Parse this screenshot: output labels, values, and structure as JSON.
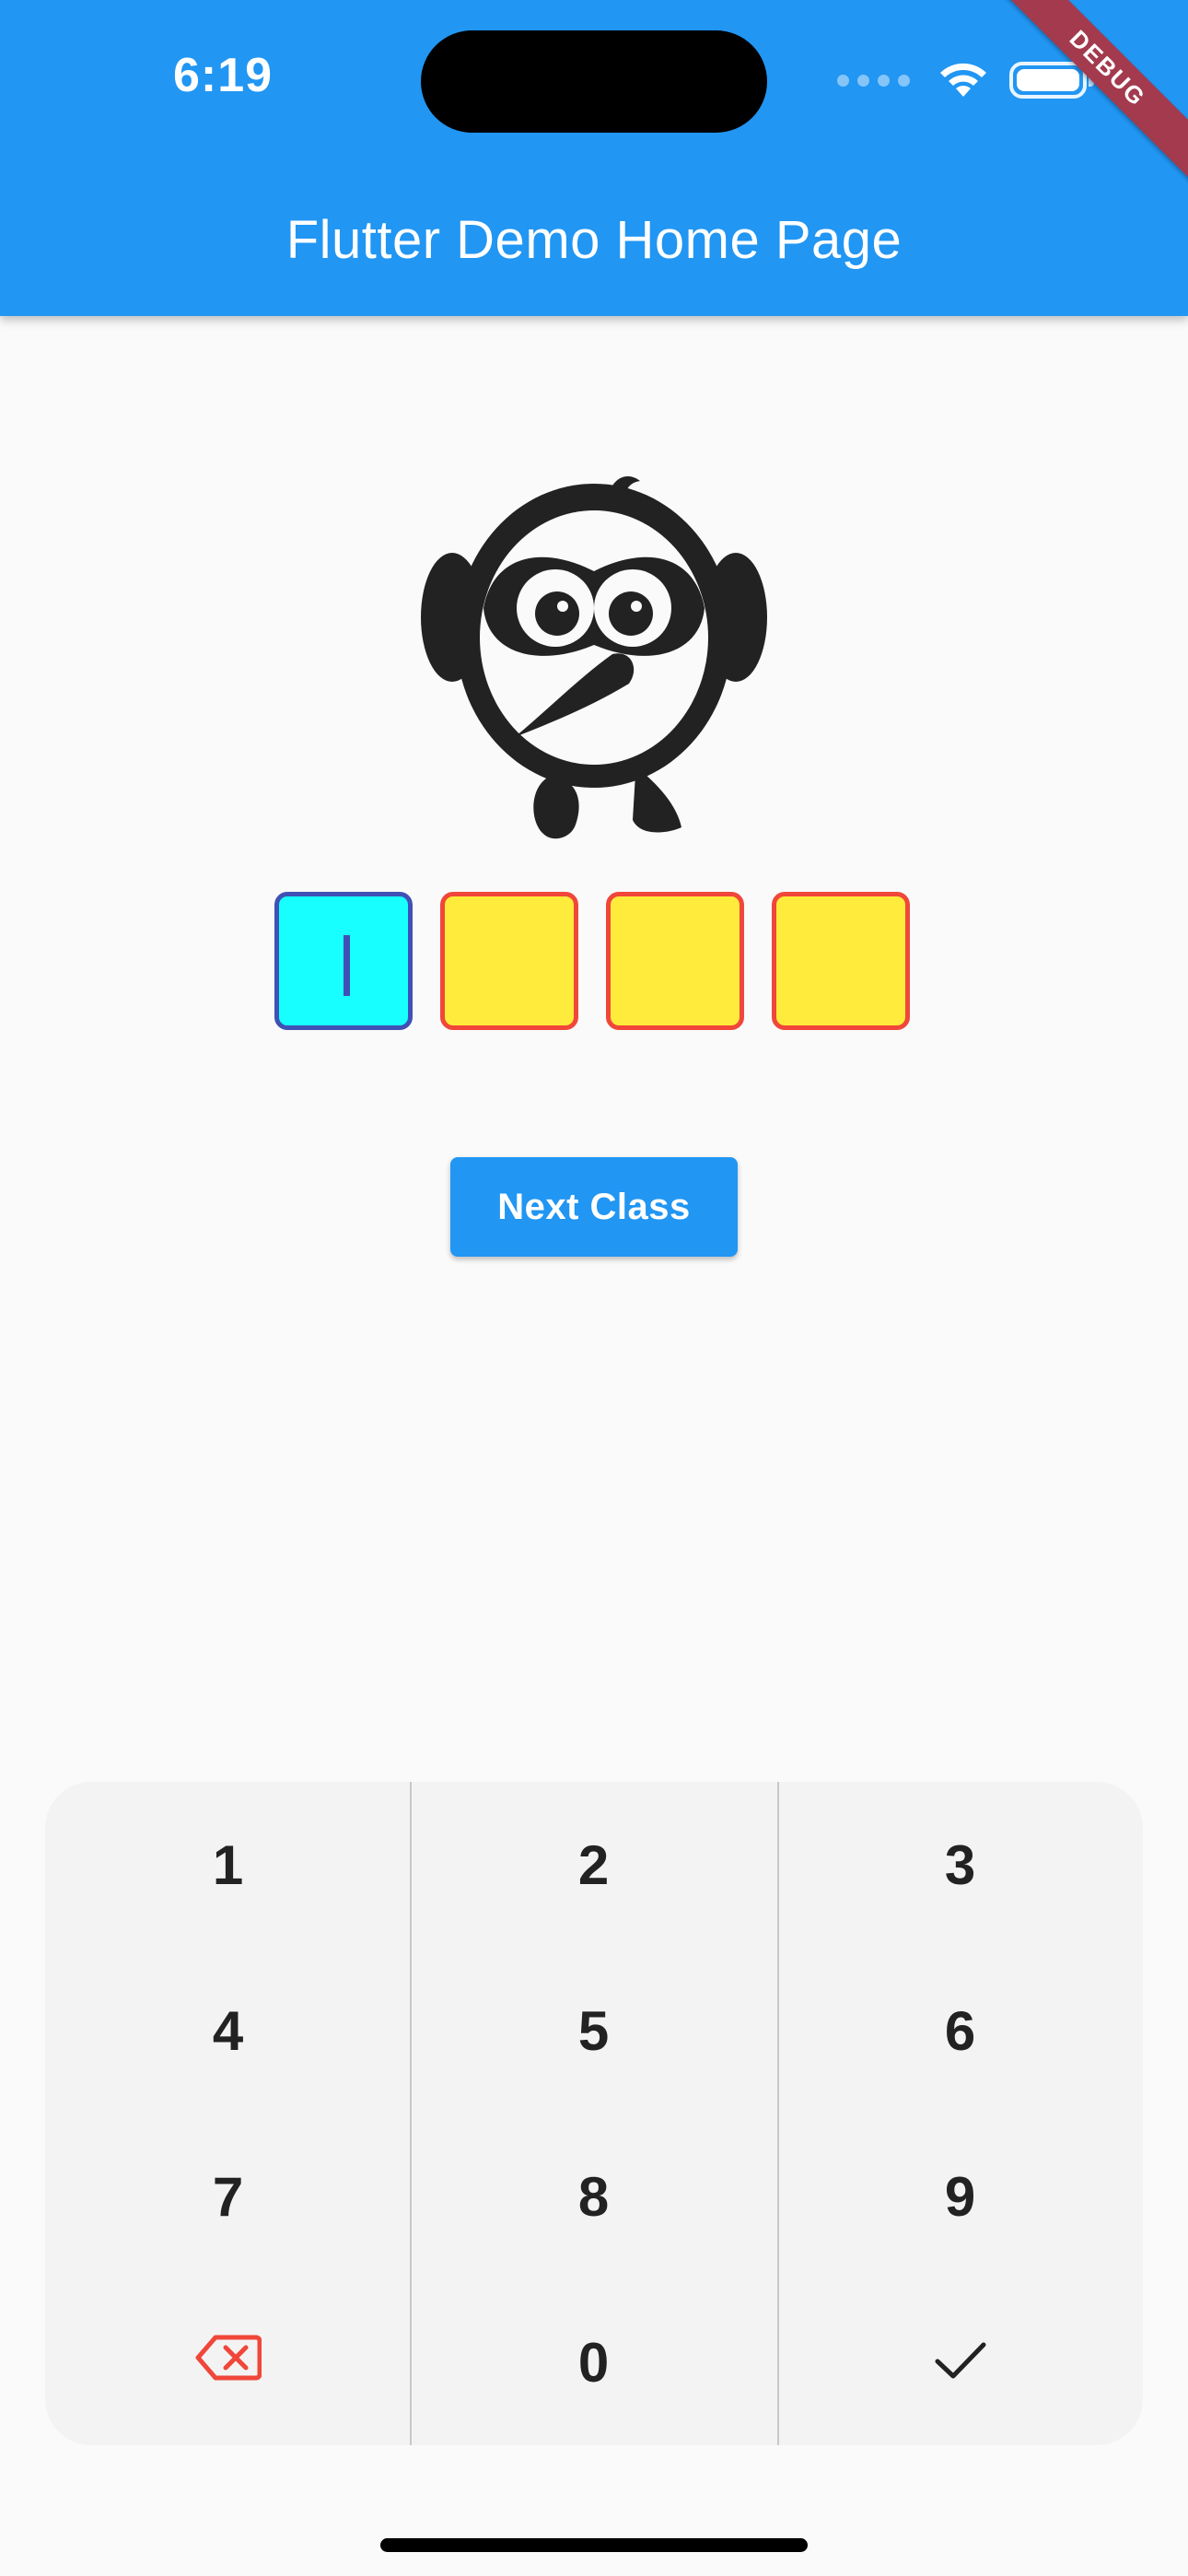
{
  "status_bar": {
    "time": "6:19",
    "icons": [
      "signal-dots-icon",
      "wifi-icon",
      "battery-icon"
    ]
  },
  "debug_banner": "DEBUG",
  "app_bar": {
    "title": "Flutter Demo Home Page",
    "color": "#2196f3"
  },
  "mascot": {
    "icon": "owl-bird-icon"
  },
  "pin": {
    "length": 4,
    "active_index": 0,
    "active_color": "#18ffff",
    "empty_color": "#ffeb3b",
    "border_color": "#f0473a",
    "active_border_color": "#3f51b5"
  },
  "next_button": {
    "label": "Next Class"
  },
  "keypad": {
    "keys": [
      {
        "label": "1"
      },
      {
        "label": "2"
      },
      {
        "label": "3"
      },
      {
        "label": "4"
      },
      {
        "label": "5"
      },
      {
        "label": "6"
      },
      {
        "label": "7"
      },
      {
        "label": "8"
      },
      {
        "label": "9"
      },
      {
        "label": "",
        "icon": "backspace-icon"
      },
      {
        "label": "0"
      },
      {
        "label": "",
        "icon": "checkmark-icon"
      }
    ],
    "backspace_color": "#f0473a"
  }
}
